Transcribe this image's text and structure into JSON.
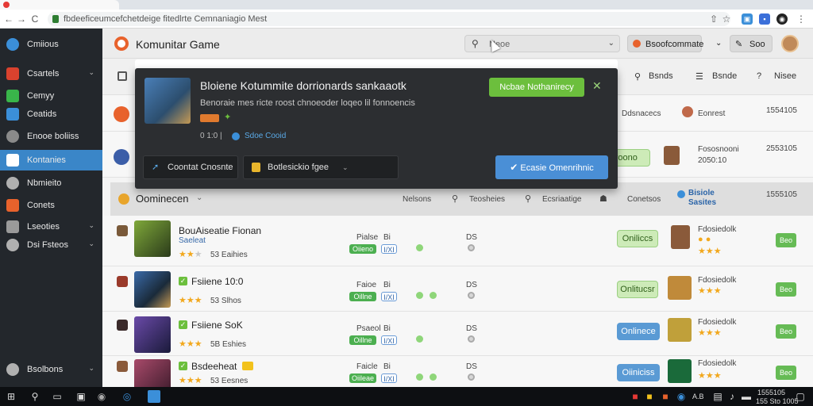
{
  "browser": {
    "url": "fbdeeficeumcefchetdeige fitedlrte Cemnaniagio Mest",
    "back": "←",
    "forward": "→",
    "reload": "C",
    "home": "⌂"
  },
  "sidebar": {
    "items": [
      {
        "label": "Cmiious",
        "color": "#3b8fd9"
      },
      {
        "label": "Csartels",
        "color": "#d9422e",
        "chevron": "⌄"
      },
      {
        "label": "Cemyy",
        "color": "#39b54a"
      },
      {
        "label": "Ceatids",
        "color": "#3b8fd9"
      },
      {
        "label": "Enooe boliiss",
        "color": "#8a8a8a"
      },
      {
        "label": "Kontanies",
        "color": "#3b8fd9",
        "active": true
      },
      {
        "label": "Nbmieito",
        "color": "#b0b0b0"
      },
      {
        "label": "Conets",
        "color": "#e8622c"
      },
      {
        "label": "Lseoties",
        "color": "#9a9a9a",
        "chevron": "⌄"
      },
      {
        "label": "Dsi Fsteos",
        "color": "#b0b0b0",
        "chevron": "⌄"
      },
      {
        "label": "Bsolbons",
        "color": "#b0b0b0",
        "chevron": "⌄"
      }
    ]
  },
  "header": {
    "title": "Komunitar Game",
    "search_placeholder": "Neoe",
    "btn_primary": "Bsoofcommate",
    "btn_secondary": "Soo"
  },
  "toolbar": {
    "items": [
      "Bsnds",
      "Bsnde",
      "Nisee"
    ]
  },
  "rows_top": [
    {
      "left": "Ddsnacecs",
      "right": "Eonrest",
      "count": "1554105"
    },
    {
      "center": "Teroono",
      "right": "Fososnooni 2050:10",
      "count": "2553105"
    }
  ],
  "section": {
    "title": "Oominecen",
    "cols": [
      "Nelsons",
      "Teosheies",
      "Ecsriaatige",
      "Conetsos",
      "Bisiole Sasites",
      "1555105"
    ]
  },
  "games": [
    {
      "name": "BouAiseatie Fionan",
      "sub": "Saeleat",
      "stars": 2,
      "rating": "53 Eaihies",
      "meta1": "Pialse",
      "meta2": "Bi",
      "pill1": "Oiieno",
      "pill2": "I/XI",
      "dots": 1,
      "btn": "Oniliccs",
      "btnStyle": "green",
      "right1": "Fdosiedolk",
      "right_stars": 2,
      "tail": "Beo"
    },
    {
      "name": "Fsiiene 10:0",
      "sub": "",
      "stars": 3,
      "rating": "53 Slhos",
      "meta1": "Faioe",
      "meta2": "Bi",
      "pill1": "Oillne",
      "pill2": "I/XI",
      "dots": 2,
      "btn": "Onlitucsr",
      "btnStyle": "green",
      "right1": "Fdosiedolk",
      "right_stars": 3,
      "tail": "Beo"
    },
    {
      "name": "Fsiiene SoK",
      "sub": "",
      "stars": 3,
      "rating": "5B Eshies",
      "meta1": "Psaeol",
      "meta2": "Bi",
      "pill1": "Oillne",
      "pill2": "I/XI",
      "dots": 1,
      "btn": "Onlinece",
      "btnStyle": "blue",
      "right1": "Fdosiedolk",
      "right_stars": 3,
      "tail": "Beo"
    },
    {
      "name": "Bsdeeheat",
      "sub": "",
      "stars": 3,
      "rating": "53 Eesnes",
      "meta1": "Faicle",
      "meta2": "Bi",
      "pill1": "Oiileae",
      "pill2": "I/XI",
      "dots": 2,
      "btn": "Oiiniciss",
      "btnStyle": "blue",
      "right1": "Fdosiedolk",
      "right_stars": 3,
      "tail": "Beo"
    }
  ],
  "popup": {
    "title": "Bloiene Kotummite dorrionards sankaaotk",
    "desc": "Benoraie mes ricte roost chnoeoder loqeo lil fonnoencis",
    "meta": "0 1:0 |",
    "link": "Sdoe Cooid",
    "accept": "Ncbae Nothanirecy",
    "close": "✕",
    "btn1": "Coontat Cnosnte",
    "btn2": "Botlesickio fgee",
    "btn3": "Ecasie Omenrihnic"
  },
  "taskbar": {
    "clock_time": "1555105",
    "clock_date": "155 Sto 1005",
    "tray": "A.B"
  }
}
